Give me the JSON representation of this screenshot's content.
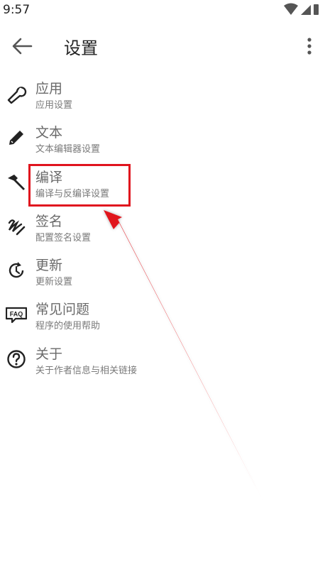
{
  "status_bar": {
    "time": "9:57"
  },
  "app_bar": {
    "title": "设置"
  },
  "settings": [
    {
      "label": "应用",
      "sub": "应用设置",
      "icon": "wrench-icon"
    },
    {
      "label": "文本",
      "sub": "文本编辑器设置",
      "icon": "pencil-icon"
    },
    {
      "label": "编译",
      "sub": "编译与反编译设置",
      "icon": "hammer-icon"
    },
    {
      "label": "签名",
      "sub": "配置签名设置",
      "icon": "signature-icon"
    },
    {
      "label": "更新",
      "sub": "更新设置",
      "icon": "update-icon"
    },
    {
      "label": "常见问题",
      "sub": "程序的使用帮助",
      "icon": "faq-icon"
    },
    {
      "label": "关于",
      "sub": "关于作者信息与相关链接",
      "icon": "help-circle-icon"
    }
  ],
  "colors": {
    "highlight": "#e0141e",
    "text_primary": "#222222",
    "text_secondary": "#7a7a7a"
  }
}
